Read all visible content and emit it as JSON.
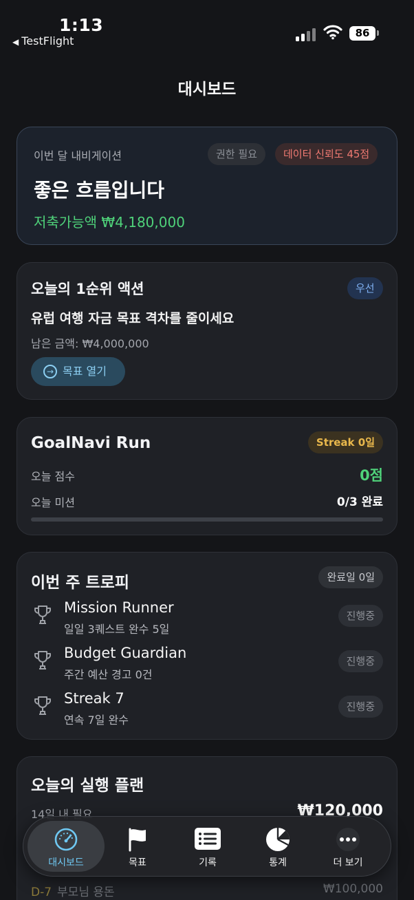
{
  "status_bar": {
    "time": "1:13",
    "back_app": "TestFlight",
    "battery": "86"
  },
  "page_title": "대시보드",
  "navigation_card": {
    "subtitle": "이번 달 내비게이션",
    "permission_chip": "권한 필요",
    "reliability_chip": "데이터 신뢰도 45점",
    "headline": "좋은 흐름입니다",
    "savings": "저축가능액 ₩4,180,000"
  },
  "priority_action": {
    "title": "오늘의 1순위 액션",
    "badge": "우선",
    "goal_text": "유럽 여행 자금 목표 격차를 줄이세요",
    "remaining": "남은 금액: ₩4,000,000",
    "button_label": "목표 열기"
  },
  "run_card": {
    "title": "GoalNavi Run",
    "streak": "Streak 0일",
    "score_label": "오늘 점수",
    "score_value": "0점",
    "mission_label": "오늘 미션",
    "mission_value": "0/3 완료",
    "progress": 0
  },
  "trophy_card": {
    "title": "이번 주 트로피",
    "completed_days": "완료일 0일",
    "items": [
      {
        "name": "Mission Runner",
        "desc": "일일 3퀘스트 완수 5일",
        "status": "진행중"
      },
      {
        "name": "Budget Guardian",
        "desc": "주간 예산 경고 0건",
        "status": "진행중"
      },
      {
        "name": "Streak 7",
        "desc": "연속 7일 완수",
        "status": "진행중"
      }
    ]
  },
  "plan_card": {
    "title": "오늘의 실행 플랜",
    "need_label": "14일 내 필요",
    "need_amount": "₩120,000",
    "row": {
      "dday": "D-7",
      "label": "부모님 용돈",
      "amount": "₩100,000"
    }
  },
  "tab_bar": {
    "tabs": [
      {
        "label": "대시보드",
        "icon": "gauge-icon",
        "active": true
      },
      {
        "label": "목표",
        "icon": "flag-icon"
      },
      {
        "label": "기록",
        "icon": "list-icon"
      },
      {
        "label": "통계",
        "icon": "pie-chart-icon"
      },
      {
        "label": "더 보기",
        "icon": "more-icon"
      }
    ]
  },
  "colors": {
    "accent_green": "#4fd27a",
    "accent_blue": "#6fc8f2",
    "warning_red": "#f07a72",
    "streak_gold": "#e9b84c"
  }
}
